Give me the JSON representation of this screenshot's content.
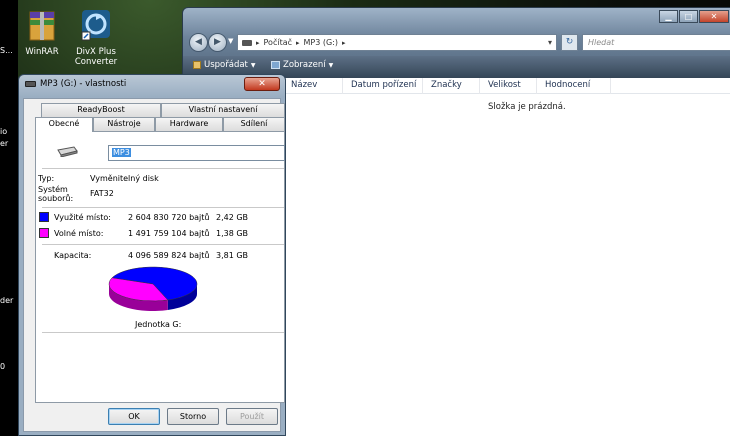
{
  "desktop": {
    "icons": [
      {
        "label": "WinRAR"
      },
      {
        "label": "DivX Plus Converter",
        "line1": "DivX Plus",
        "line2": "Converter"
      }
    ],
    "strip_fragments": [
      "S...",
      "io",
      "er",
      "der",
      "0"
    ]
  },
  "explorer": {
    "address": {
      "computer": "Počítač",
      "drive": "MP3 (G:)"
    },
    "search_placeholder": "Hledat",
    "toolbar": {
      "organize": "Uspořádat",
      "views": "Zobrazení"
    },
    "columns": [
      "Název",
      "Datum pořízení",
      "Značky",
      "Velikost",
      "Hodnocení"
    ],
    "empty_message": "Složka je prázdná."
  },
  "properties": {
    "title": "MP3 (G:) - vlastnosti",
    "tabs_top": [
      "ReadyBoost",
      "Vlastní nastavení"
    ],
    "tabs_bottom": [
      "Obecné",
      "Nástroje",
      "Hardware",
      "Sdílení"
    ],
    "drive_name": "MP3",
    "type_label": "Typ:",
    "type_value": "Vyměnitelný disk",
    "fs_label_1": "Systém",
    "fs_label_2": "souborů:",
    "fs_value": "FAT32",
    "used": {
      "label": "Využité místo:",
      "bytes": "2 604 830 720 bajtů",
      "size": "2,42 GB",
      "color": "#0000ff"
    },
    "free": {
      "label": "Volné místo:",
      "bytes": "1 491 759 104 bajtů",
      "size": "1,38 GB",
      "color": "#ff00ff"
    },
    "capacity": {
      "label": "Kapacita:",
      "bytes": "4 096 589 824 bajtů",
      "size": "3,81 GB"
    },
    "used_fraction": 0.636,
    "drive_label": "Jednotka G:",
    "buttons": {
      "ok": "OK",
      "cancel": "Storno",
      "apply": "Použít"
    }
  }
}
